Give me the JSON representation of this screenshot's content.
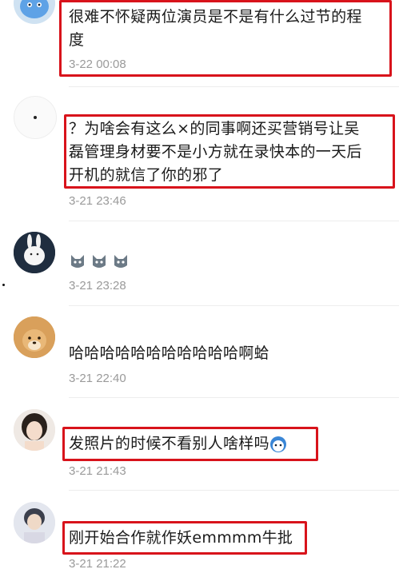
{
  "comments": [
    {
      "avatar": "blue-cartoon-avatar",
      "text_lines": [
        "很难不怀疑两位演员是不是有什么过节的程",
        "度"
      ],
      "time": "3-22 00:08",
      "highlighted": true
    },
    {
      "avatar": "white-dot-avatar",
      "text_lines": [
        "？为啥会有这么×的同事啊还买营销号让吴",
        "磊管理身材要不是小方就在录快本的一天后",
        "开机的就信了你的邪了"
      ],
      "time": "3-21 23:46",
      "highlighted": true
    },
    {
      "avatar": "white-rabbit-avatar",
      "emojis": [
        "cat-face-emoji",
        "cat-face-emoji",
        "cat-face-emoji"
      ],
      "time": "3-21 23:28",
      "highlighted": false
    },
    {
      "avatar": "shiba-dog-avatar",
      "text": "哈哈哈哈哈哈哈哈哈哈哈啊蛤",
      "time": "3-21 22:40",
      "highlighted": false
    },
    {
      "avatar": "girl-portrait-avatar",
      "text": "发照片的时候不看别人啥样吗",
      "trailing_emoji": "blue-face-emoji",
      "time": "3-21 21:43",
      "highlighted": true
    },
    {
      "avatar": "person-portrait-avatar",
      "text": "刚开始合作就作妖emmmm牛批",
      "time": "3-21 21:22",
      "highlighted": true
    }
  ],
  "colors": {
    "highlight_border": "#d8131b",
    "timestamp": "#9a9a9a",
    "text": "#1a1a1a"
  }
}
